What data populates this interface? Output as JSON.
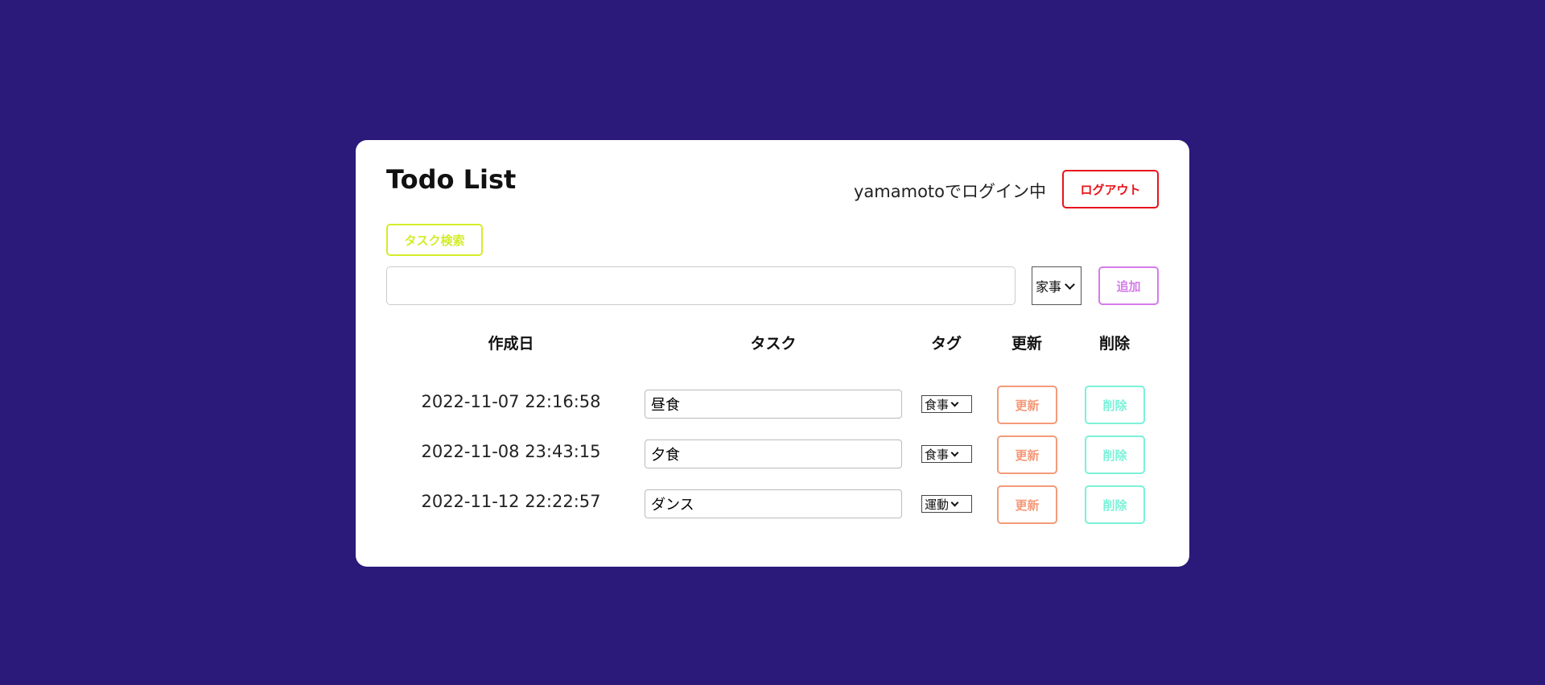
{
  "header": {
    "title": "Todo List",
    "login_status": "yamamotoでログイン中",
    "logout_label": "ログアウト"
  },
  "search": {
    "button_label": "タスク検索"
  },
  "new_task": {
    "value": "",
    "tag_selected": "家事",
    "add_label": "追加"
  },
  "table": {
    "headers": {
      "created": "作成日",
      "task": "タスク",
      "tag": "タグ",
      "update": "更新",
      "delete": "削除"
    },
    "rows": [
      {
        "created": "2022-11-07 22:16:58",
        "task": "昼食",
        "tag": "食事",
        "update_label": "更新",
        "delete_label": "削除"
      },
      {
        "created": "2022-11-08 23:43:15",
        "task": "夕食",
        "tag": "食事",
        "update_label": "更新",
        "delete_label": "削除"
      },
      {
        "created": "2022-11-12 22:22:57",
        "task": "ダンス",
        "tag": "運動",
        "update_label": "更新",
        "delete_label": "削除"
      }
    ]
  },
  "colors": {
    "background": "#2c1a7a",
    "logout": "#e8121b",
    "search": "#d4ec2a",
    "add": "#d47bea",
    "update": "#f49a7a",
    "delete": "#7cf1d8"
  }
}
